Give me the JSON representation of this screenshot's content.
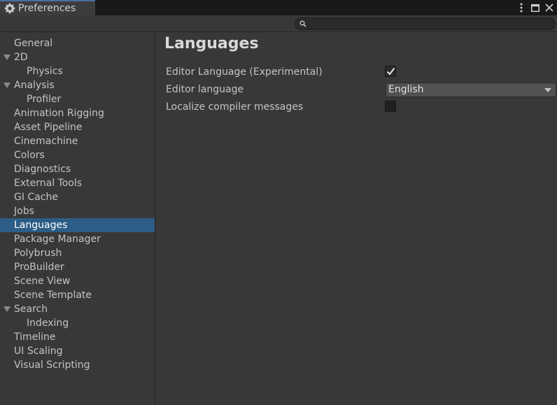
{
  "window": {
    "tab_title": "Preferences"
  },
  "search": {
    "value": ""
  },
  "sidebar": {
    "items": [
      {
        "label": "General",
        "level": 0,
        "expandable": false,
        "selected": false
      },
      {
        "label": "2D",
        "level": 0,
        "expandable": true,
        "selected": false
      },
      {
        "label": "Physics",
        "level": 1,
        "expandable": false,
        "selected": false
      },
      {
        "label": "Analysis",
        "level": 0,
        "expandable": true,
        "selected": false
      },
      {
        "label": "Profiler",
        "level": 1,
        "expandable": false,
        "selected": false
      },
      {
        "label": "Animation Rigging",
        "level": 0,
        "expandable": false,
        "selected": false
      },
      {
        "label": "Asset Pipeline",
        "level": 0,
        "expandable": false,
        "selected": false
      },
      {
        "label": "Cinemachine",
        "level": 0,
        "expandable": false,
        "selected": false
      },
      {
        "label": "Colors",
        "level": 0,
        "expandable": false,
        "selected": false
      },
      {
        "label": "Diagnostics",
        "level": 0,
        "expandable": false,
        "selected": false
      },
      {
        "label": "External Tools",
        "level": 0,
        "expandable": false,
        "selected": false
      },
      {
        "label": "GI Cache",
        "level": 0,
        "expandable": false,
        "selected": false
      },
      {
        "label": "Jobs",
        "level": 0,
        "expandable": false,
        "selected": false
      },
      {
        "label": "Languages",
        "level": 0,
        "expandable": false,
        "selected": true
      },
      {
        "label": "Package Manager",
        "level": 0,
        "expandable": false,
        "selected": false
      },
      {
        "label": "Polybrush",
        "level": 0,
        "expandable": false,
        "selected": false
      },
      {
        "label": "ProBuilder",
        "level": 0,
        "expandable": false,
        "selected": false
      },
      {
        "label": "Scene View",
        "level": 0,
        "expandable": false,
        "selected": false
      },
      {
        "label": "Scene Template",
        "level": 0,
        "expandable": false,
        "selected": false
      },
      {
        "label": "Search",
        "level": 0,
        "expandable": true,
        "selected": false
      },
      {
        "label": "Indexing",
        "level": 1,
        "expandable": false,
        "selected": false
      },
      {
        "label": "Timeline",
        "level": 0,
        "expandable": false,
        "selected": false
      },
      {
        "label": "UI Scaling",
        "level": 0,
        "expandable": false,
        "selected": false
      },
      {
        "label": "Visual Scripting",
        "level": 0,
        "expandable": false,
        "selected": false
      }
    ]
  },
  "main": {
    "title": "Languages",
    "settings": {
      "editor_language_experimental": {
        "label": "Editor Language (Experimental)",
        "checked": true
      },
      "editor_language": {
        "label": "Editor language",
        "value": "English"
      },
      "localize_compiler_messages": {
        "label": "Localize compiler messages",
        "checked": false
      }
    }
  },
  "colors": {
    "background": "#383838",
    "selection": "#2c5d87",
    "tabbar": "#191919"
  },
  "icons": {
    "tab": "gear-icon",
    "menu": "more-vertical-icon",
    "maximize": "maximize-icon",
    "close": "close-icon",
    "search": "search-icon",
    "expand": "expand-arrow-icon",
    "dropdown": "chevron-down-icon",
    "check": "checkmark-icon"
  }
}
